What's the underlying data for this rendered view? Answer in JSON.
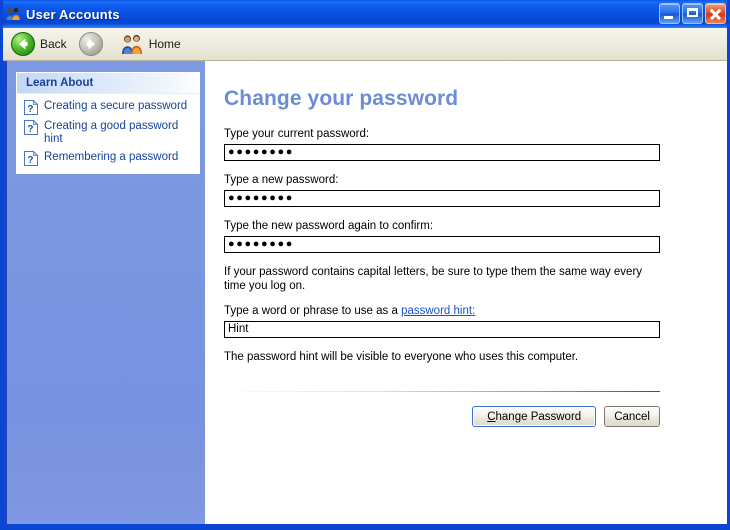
{
  "window": {
    "title": "User Accounts",
    "title_icon": "users-icon",
    "controls": {
      "minimize": "minimize-button",
      "maximize": "maximize-button",
      "close": "close-button"
    }
  },
  "toolbar": {
    "back": {
      "label": "Back",
      "icon": "back-arrow-icon",
      "enabled": true
    },
    "forward": {
      "label": "",
      "icon": "forward-arrow-icon",
      "enabled": false
    },
    "home": {
      "label": "Home",
      "icon": "home-users-icon",
      "enabled": true
    }
  },
  "sidebar": {
    "panel_title": "Learn About",
    "links": [
      {
        "label": "Creating a secure password",
        "icon": "help-question-icon"
      },
      {
        "label": "Creating a good password hint",
        "icon": "help-question-icon"
      },
      {
        "label": "Remembering a password",
        "icon": "help-question-icon"
      }
    ]
  },
  "main": {
    "heading": "Change your password",
    "fields": {
      "current_password": {
        "label": "Type your current password:",
        "value": "●●●●●●●●",
        "masked": true
      },
      "new_password": {
        "label": "Type a new password:",
        "value": "●●●●●●●●",
        "masked": true
      },
      "confirm_password": {
        "label": "Type the new password again to confirm:",
        "value": "●●●●●●●●",
        "masked": true
      },
      "hint": {
        "label_prefix": "Type a word or phrase to use as a ",
        "label_link": "password hint:",
        "value": "Hint",
        "masked": false
      }
    },
    "caps_note": "If your password contains capital letters, be sure to type them the same way every time you log on.",
    "hint_note": "The password hint will be visible to everyone who uses this computer.",
    "buttons": {
      "primary": {
        "accel": "C",
        "rest": "hange Password",
        "full": "Change Password",
        "is_default": true
      },
      "cancel": {
        "label": "Cancel",
        "is_default": false
      }
    }
  },
  "colors": {
    "titlebar_blue": "#0a4fe0",
    "window_border": "#0a46d2",
    "sidebar_blue": "#7a96e1",
    "heading_blue": "#6c8cd5",
    "link_blue": "#15439b",
    "panel_header_text": "#16409c",
    "toolbar_beige": "#edebdd",
    "close_red": "#e2512a"
  }
}
